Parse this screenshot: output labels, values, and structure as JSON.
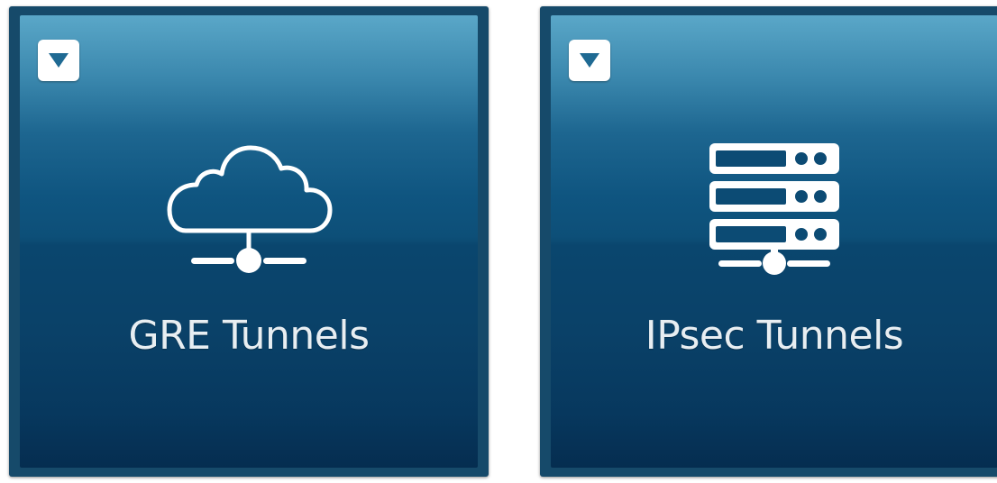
{
  "tiles": [
    {
      "label": "GRE Tunnels",
      "icon": "cloud-network-icon",
      "menu_icon": "dropdown-triangle-icon"
    },
    {
      "label": "IPsec Tunnels",
      "icon": "server-network-icon",
      "menu_icon": "dropdown-triangle-icon"
    }
  ],
  "colors": {
    "tile_top": "#5aa7c8",
    "tile_mid": "#0f5580",
    "tile_bottom": "#052d50",
    "tile_frame": "#164a6a",
    "dropdown_bg": "#ffffff",
    "dropdown_arrow": "#1f6a93",
    "label_text": "#e8eef2"
  }
}
